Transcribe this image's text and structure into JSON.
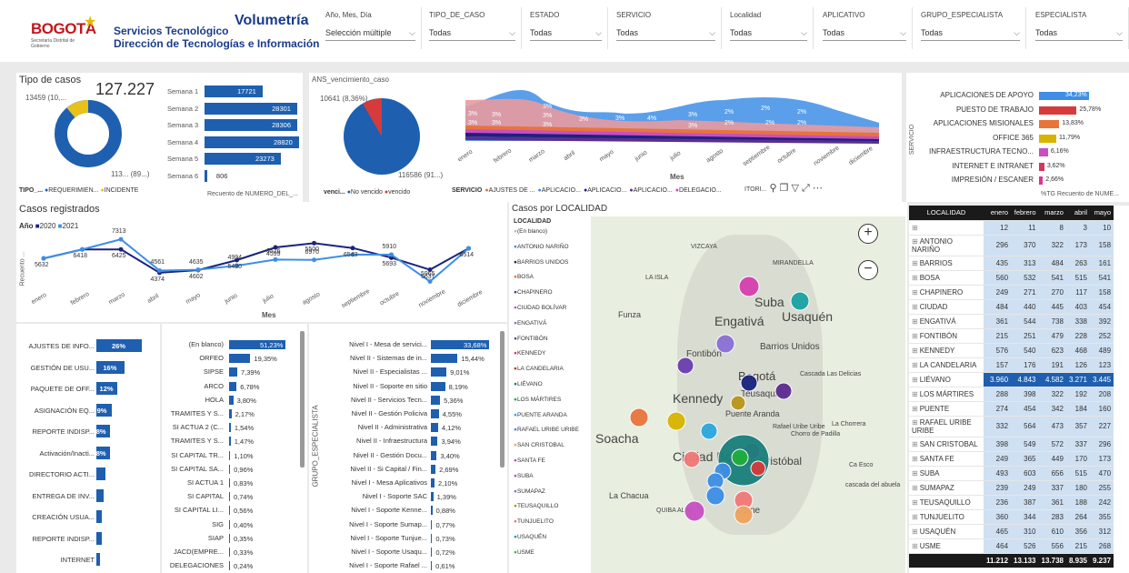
{
  "header": {
    "logo_text": "BOGOTÁ",
    "logo_sub": "Secretaría Distrital de Gobierno",
    "title1": "Servicios Tecnológico",
    "title2": "Dirección de Tecnologías e Información",
    "report_title": "Volumetría"
  },
  "slicers": [
    {
      "label": "Año, Mes, Día",
      "value": "Selección múltiple"
    },
    {
      "label": "TIPO_DE_CASO",
      "value": "Todas"
    },
    {
      "label": "ESTADO",
      "value": "Todas"
    },
    {
      "label": "SERVICIO",
      "value": "Todas"
    },
    {
      "label": "Localidad",
      "value": "Todas"
    },
    {
      "label": "APLICATIVO",
      "value": "Todas"
    },
    {
      "label": "GRUPO_ESPECIALISTA",
      "value": "Todas"
    },
    {
      "label": "ESPECIALISTA",
      "value": "Todas"
    }
  ],
  "tipo_casos": {
    "title": "Tipo de casos",
    "total": "127.227",
    "label_top": "13459 (10,...",
    "label_bottom": "113... (89...)",
    "legend_title": "TIPO_...",
    "legend": [
      "REQUERIMIEN...",
      "INCIDENTE"
    ],
    "colors": [
      "#1e5fb0",
      "#e6c21a"
    ]
  },
  "semanas": {
    "xlabel": "Recuento de NUMERO_DEL_...",
    "items": [
      {
        "label": "Semana 1",
        "value": "17721",
        "n": 17721
      },
      {
        "label": "Semana 2",
        "value": "28301",
        "n": 28301
      },
      {
        "label": "Semana 3",
        "value": "28306",
        "n": 28306
      },
      {
        "label": "Semana 4",
        "value": "28820",
        "n": 28820
      },
      {
        "label": "Semana 5",
        "value": "23273",
        "n": 23273
      },
      {
        "label": "Semana 6",
        "value": "806",
        "n": 806
      }
    ]
  },
  "ans": {
    "title": "ANS_vencimiento_caso",
    "label_top": "10641 (8,36%)",
    "label_bottom": "116586 (91...)",
    "legend_title": "venci...",
    "legend": [
      "No vencido",
      "vencido"
    ],
    "colors": [
      "#1e5fb0",
      "#d63b3b"
    ]
  },
  "ribbon": {
    "months": [
      "enero",
      "febrero",
      "marzo",
      "abril",
      "mayo",
      "junio",
      "julio",
      "agosto",
      "septiembre",
      "octubre",
      "noviembre",
      "diciembre"
    ],
    "xlabel": "Mes",
    "legend_title": "SERVICIO",
    "legend": [
      "AJUSTES DE ...",
      "APLICACIO...",
      "APLICACIO...",
      "APLICACIO...",
      "DELEGACIO..."
    ],
    "legend_colors": [
      "#e8743b",
      "#3e8ee6",
      "#1a237e",
      "#5c2d91",
      "#c74fc2"
    ],
    "labels": [
      "3%",
      "3%",
      "3%",
      "3%",
      "3%",
      "3%",
      "3%",
      "3%",
      "3%",
      "4%",
      "3%",
      "3%",
      "2%",
      "2%",
      "2%",
      "2%",
      "2%",
      "2%",
      "2%",
      "2%"
    ]
  },
  "toolbar": {
    "trunc": "ITORI...",
    "icons": [
      "pin-icon",
      "copy-icon",
      "filter-icon",
      "expand-icon",
      "more-icon"
    ]
  },
  "servicio": {
    "axis": "SERVICIO",
    "xlabel": "%TG Recuento de NUME...",
    "items": [
      {
        "label": "APLICACIONES DE APOYO",
        "value": "34,23%",
        "n": 34.23,
        "color": "#3e8ee6"
      },
      {
        "label": "PUESTO DE TRABAJO",
        "value": "25,78%",
        "n": 25.78,
        "color": "#d63b3b"
      },
      {
        "label": "APLICACIONES MISIONALES",
        "value": "13,83%",
        "n": 13.83,
        "color": "#e8743b"
      },
      {
        "label": "OFFICE 365",
        "value": "11,79%",
        "n": 11.79,
        "color": "#d8b400"
      },
      {
        "label": "INFRAESTRUCTURA TECNO...",
        "value": "6,16%",
        "n": 6.16,
        "color": "#c74fc2"
      },
      {
        "label": "INTERNET E INTRANET",
        "value": "3,62%",
        "n": 3.62,
        "color": "#d4365f"
      },
      {
        "label": "IMPRESIÓN / ESCANER",
        "value": "2,66%",
        "n": 2.66,
        "color": "#e0338f"
      }
    ]
  },
  "casos_reg": {
    "title": "Casos registrados",
    "legend_title": "Año",
    "legend": [
      "2020",
      "2021"
    ],
    "ylabel": "Recuento ...",
    "xlabel": "Mes",
    "months": [
      "enero",
      "febrero",
      "marzo",
      "abril",
      "mayo",
      "junio",
      "julio",
      "agosto",
      "septiembre",
      "octubre",
      "noviembre",
      "diciembre"
    ],
    "s2020": [
      5632,
      6418,
      6425,
      4374,
      4602,
      5480,
      6599,
      6970,
      6543,
      5693,
      4637,
      6514
    ],
    "s2021": [
      5632,
      6418,
      7313,
      4561,
      4635,
      4994,
      5526,
      5500,
      5970,
      5965,
      3600,
      6514
    ],
    "labels_top": [
      "",
      "",
      "7313",
      "4561",
      "4635",
      "4994",
      "6526",
      "6970",
      "",
      "5910",
      "5965",
      ""
    ],
    "labels_bot": [
      "5632",
      "6418",
      "6425",
      "4374",
      "4602",
      "5480",
      "4599",
      "5500",
      "6543",
      "5693",
      "5637",
      "6514"
    ]
  },
  "aplicativo": {
    "items": [
      {
        "label": "AJUSTES DE INFO...",
        "value": "26%",
        "n": 26
      },
      {
        "label": "GESTIÓN DE USU...",
        "value": "16%",
        "n": 16
      },
      {
        "label": "PAQUETE DE OFF...",
        "value": "12%",
        "n": 12
      },
      {
        "label": "ASIGNACIÓN EQ...",
        "value": "9%",
        "n": 9
      },
      {
        "label": "REPORTE INDISP...",
        "value": "8%",
        "n": 8
      },
      {
        "label": "Activación/Inacti...",
        "value": "8%",
        "n": 8
      },
      {
        "label": "DIRECTORIO ACTI...",
        "value": "",
        "n": 5
      },
      {
        "label": "ENTREGA DE INV...",
        "value": "",
        "n": 4
      },
      {
        "label": "CREACIÓN USUA...",
        "value": "",
        "n": 3
      },
      {
        "label": "REPORTE INDISP...",
        "value": "",
        "n": 3
      },
      {
        "label": "INTERNET",
        "value": "",
        "n": 2
      }
    ]
  },
  "ubicacion": {
    "items": [
      {
        "label": "(En blanco)",
        "value": "51,23%",
        "n": 51.23
      },
      {
        "label": "ORFEO",
        "value": "19,35%",
        "n": 19.35
      },
      {
        "label": "SIPSE",
        "value": "7,39%",
        "n": 7.39
      },
      {
        "label": "ARCO",
        "value": "6,78%",
        "n": 6.78
      },
      {
        "label": "HOLA",
        "value": "3,80%",
        "n": 3.8
      },
      {
        "label": "TRAMITES Y S...",
        "value": "2,17%",
        "n": 2.17
      },
      {
        "label": "SI ACTUA 2 (C...",
        "value": "1,54%",
        "n": 1.54
      },
      {
        "label": "TRAMITES Y S...",
        "value": "1,47%",
        "n": 1.47
      },
      {
        "label": "SI CAPITAL TR...",
        "value": "1,10%",
        "n": 1.1
      },
      {
        "label": "SI CAPITAL SA...",
        "value": "0,96%",
        "n": 0.96
      },
      {
        "label": "SI ACTUA 1",
        "value": "0,83%",
        "n": 0.83
      },
      {
        "label": "SI CAPITAL",
        "value": "0,74%",
        "n": 0.74
      },
      {
        "label": "SI CAPITAL LI...",
        "value": "0,56%",
        "n": 0.56
      },
      {
        "label": "SIG",
        "value": "0,40%",
        "n": 0.4
      },
      {
        "label": "SIAP",
        "value": "0,35%",
        "n": 0.35
      },
      {
        "label": "JACD(EMPRE...",
        "value": "0,33%",
        "n": 0.33
      },
      {
        "label": "DELEGACIONES",
        "value": "0,24%",
        "n": 0.24
      }
    ]
  },
  "grupo": {
    "axis": "GRUPO_ESPECIALISTA",
    "items": [
      {
        "label": "Nivel I - Mesa de servici...",
        "value": "33,68%",
        "n": 33.68
      },
      {
        "label": "Nivel II - Sistemas de in...",
        "value": "15,44%",
        "n": 15.44
      },
      {
        "label": "Nivel II - Especialistas ...",
        "value": "9,01%",
        "n": 9.01
      },
      {
        "label": "Nivel II - Soporte en sitio",
        "value": "8,19%",
        "n": 8.19
      },
      {
        "label": "Nivel II - Servicios Tecn...",
        "value": "5,36%",
        "n": 5.36
      },
      {
        "label": "Nivel II - Gestión Policiva",
        "value": "4,55%",
        "n": 4.55
      },
      {
        "label": "Nivel II - Administrativa",
        "value": "4,12%",
        "n": 4.12
      },
      {
        "label": "Nivel II - Infraestructura",
        "value": "3,94%",
        "n": 3.94
      },
      {
        "label": "Nivel II - Gestión Docu...",
        "value": "3,40%",
        "n": 3.4
      },
      {
        "label": "Nivel II - Si Capital / Fin...",
        "value": "2,69%",
        "n": 2.69
      },
      {
        "label": "Nivel I - Mesa Aplicativos",
        "value": "2,10%",
        "n": 2.1
      },
      {
        "label": "Nivel I - Soporte SAC",
        "value": "1,39%",
        "n": 1.39
      },
      {
        "label": "Nivel I - Soporte Kenne...",
        "value": "0,88%",
        "n": 0.88
      },
      {
        "label": "Nivel I - Soporte Sumap...",
        "value": "0,77%",
        "n": 0.77
      },
      {
        "label": "Nivel I - Soporte Tunjue...",
        "value": "0,73%",
        "n": 0.73
      },
      {
        "label": "Nivel I - Soporte Usaqu...",
        "value": "0,72%",
        "n": 0.72
      },
      {
        "label": "Nivel I - Soporte Rafael ...",
        "value": "0,61%",
        "n": 0.61
      }
    ]
  },
  "mapa": {
    "title": "Casos por LOCALIDAD",
    "legend_title": "LOCALIDAD",
    "legend": [
      {
        "label": "(En blanco)",
        "color": "#bdbdbd"
      },
      {
        "label": "ANTONIO NARIÑO",
        "color": "#3e8ee6"
      },
      {
        "label": "BARRIOS UNIDOS",
        "color": "#1a237e"
      },
      {
        "label": "BOSA",
        "color": "#e8743b"
      },
      {
        "label": "CHAPINERO",
        "color": "#5c2d91"
      },
      {
        "label": "CIUDAD BOLÍVAR",
        "color": "#c74fc2"
      },
      {
        "label": "ENGATIVÁ",
        "color": "#8a6fd6"
      },
      {
        "label": "FONTIBÓN",
        "color": "#6a3fb0"
      },
      {
        "label": "KENNEDY",
        "color": "#e0338f"
      },
      {
        "label": "LA CANDELARIA",
        "color": "#c0392b"
      },
      {
        "label": "LIÉVANO",
        "color": "#1a7f7a"
      },
      {
        "label": "LOS MÁRTIRES",
        "color": "#1fae3a"
      },
      {
        "label": "PUENTE ARANDA",
        "color": "#2aa8e0"
      },
      {
        "label": "RAFAEL URIBE URIBE",
        "color": "#3e8ee6"
      },
      {
        "label": "SAN CRISTOBAL",
        "color": "#f0a35e"
      },
      {
        "label": "SANTA FE",
        "color": "#d63fb0"
      },
      {
        "label": "SUBA",
        "color": "#b04fd6"
      },
      {
        "label": "SUMAPAZ",
        "color": "#8a6fd6"
      },
      {
        "label": "TEUSAQUILLO",
        "color": "#b8961a"
      },
      {
        "label": "TUNJUELITO",
        "color": "#f07878"
      },
      {
        "label": "USAQUÉN",
        "color": "#1aa3a3"
      },
      {
        "label": "USME",
        "color": "#2dbf5a"
      }
    ],
    "places": [
      "VIZCAYA",
      "MIRANDELLA",
      "LA ISLA",
      "Suba",
      "Usaquén",
      "Funza",
      "Engativá",
      "Barrios Unidos",
      "Fontibón",
      "Bogotá",
      "Cascada Las Delicias",
      "Teusaquillo",
      "Kennedy",
      "Rafael Uribe Uribe",
      "La Chorrera",
      "Soacha",
      "Ciudad Bolívar",
      "San Cristóbal",
      "La Chacua",
      "QUIBA ALTA",
      "Usme",
      "cascada del abuela",
      "Chorro de Padilla",
      "Puente Aranda",
      "Ca Esco"
    ],
    "zoom_in": "+",
    "zoom_out": "−"
  },
  "tabla": {
    "headers": [
      "LOCALIDAD",
      "enero",
      "febrero",
      "marzo",
      "abril",
      "mayo"
    ],
    "rows": [
      {
        "loc": "",
        "v": [
          "12",
          "11",
          "8",
          "3",
          "10"
        ]
      },
      {
        "loc": "ANTONIO NARIÑO",
        "v": [
          "296",
          "370",
          "322",
          "173",
          "158"
        ]
      },
      {
        "loc": "BARRIOS",
        "v": [
          "435",
          "313",
          "484",
          "263",
          "161"
        ]
      },
      {
        "loc": "BOSA",
        "v": [
          "560",
          "532",
          "541",
          "515",
          "541"
        ]
      },
      {
        "loc": "CHAPINERO",
        "v": [
          "249",
          "271",
          "270",
          "117",
          "158"
        ]
      },
      {
        "loc": "CIUDAD",
        "v": [
          "484",
          "440",
          "445",
          "403",
          "454"
        ]
      },
      {
        "loc": "ENGATIVÁ",
        "v": [
          "361",
          "544",
          "738",
          "338",
          "392"
        ]
      },
      {
        "loc": "FONTIBÓN",
        "v": [
          "215",
          "251",
          "479",
          "228",
          "252"
        ]
      },
      {
        "loc": "KENNEDY",
        "v": [
          "576",
          "540",
          "623",
          "468",
          "489"
        ]
      },
      {
        "loc": "LA CANDELARIA",
        "v": [
          "157",
          "176",
          "191",
          "126",
          "123"
        ]
      },
      {
        "loc": "LIÉVANO",
        "v": [
          "3.960",
          "4.843",
          "4.582",
          "3.271",
          "3.445"
        ]
      },
      {
        "loc": "LOS MÁRTIRES",
        "v": [
          "288",
          "398",
          "322",
          "192",
          "208"
        ]
      },
      {
        "loc": "PUENTE",
        "v": [
          "274",
          "454",
          "342",
          "184",
          "160"
        ]
      },
      {
        "loc": "RAFAEL URIBE URIBE",
        "v": [
          "332",
          "564",
          "473",
          "357",
          "227"
        ]
      },
      {
        "loc": "SAN CRISTOBAL",
        "v": [
          "398",
          "549",
          "572",
          "337",
          "296"
        ]
      },
      {
        "loc": "SANTA FE",
        "v": [
          "249",
          "365",
          "449",
          "170",
          "173"
        ]
      },
      {
        "loc": "SUBA",
        "v": [
          "493",
          "603",
          "656",
          "515",
          "470"
        ]
      },
      {
        "loc": "SUMAPAZ",
        "v": [
          "239",
          "249",
          "337",
          "180",
          "255"
        ]
      },
      {
        "loc": "TEUSAQUILLO",
        "v": [
          "236",
          "387",
          "361",
          "188",
          "242"
        ]
      },
      {
        "loc": "TUNJUELITO",
        "v": [
          "360",
          "344",
          "283",
          "264",
          "355"
        ]
      },
      {
        "loc": "USAQUÉN",
        "v": [
          "465",
          "310",
          "610",
          "356",
          "312"
        ]
      },
      {
        "loc": "USME",
        "v": [
          "464",
          "526",
          "556",
          "215",
          "268"
        ]
      }
    ],
    "total": [
      "11.212",
      "13.133",
      "13.738",
      "8.935",
      "9.237"
    ]
  }
}
